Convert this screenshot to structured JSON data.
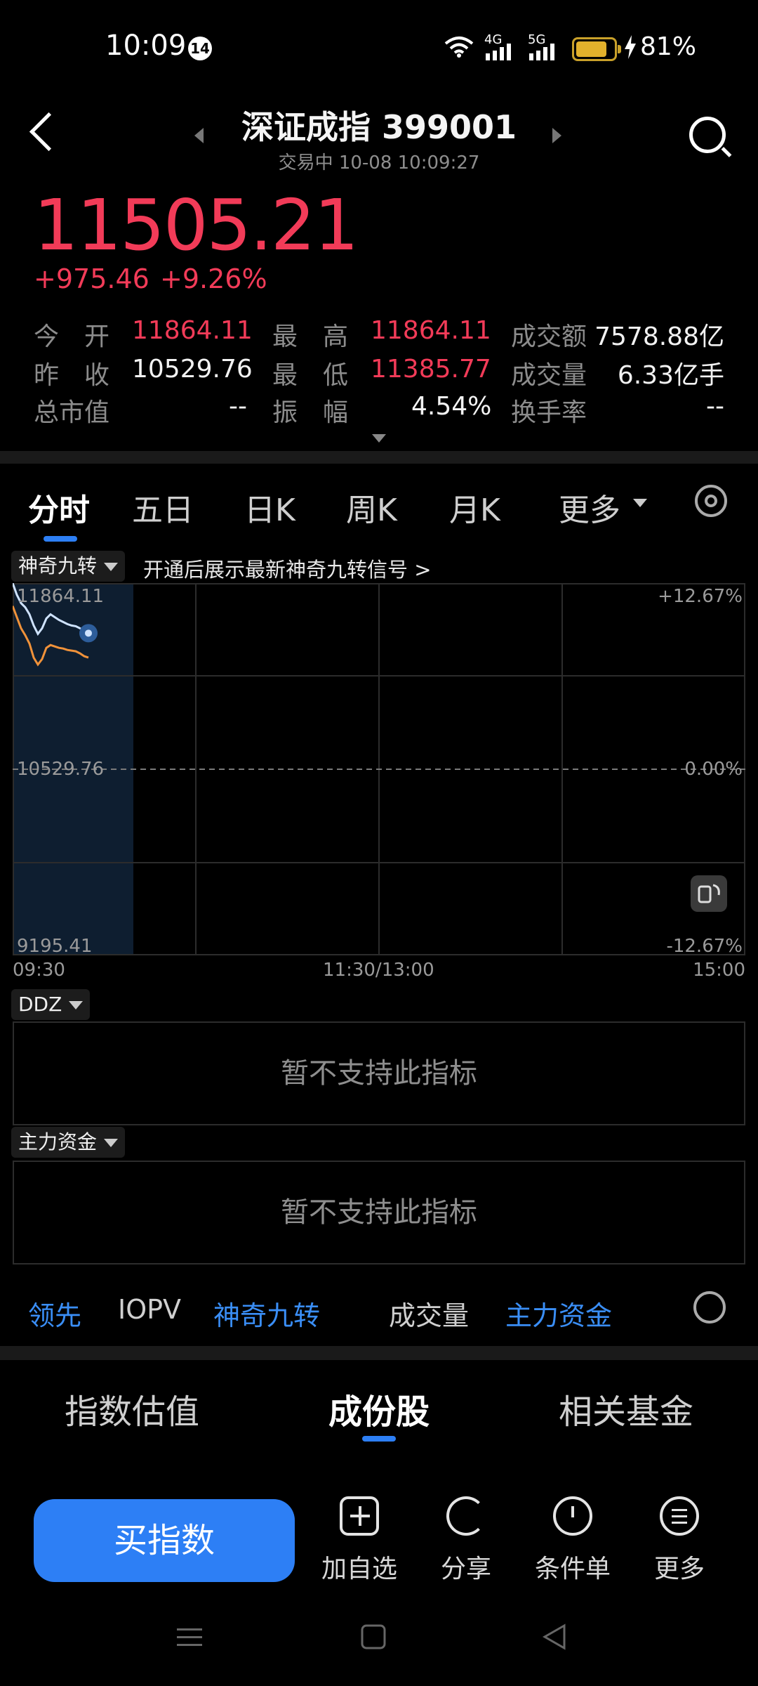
{
  "status_bar": {
    "time": "10:09",
    "notif_count": "14",
    "net1": "4G",
    "net2": "5G",
    "battery": "81%"
  },
  "header": {
    "title": "深证成指 399001",
    "subtitle": "交易中 10-08 10:09:27"
  },
  "quote": {
    "price": "11505.21",
    "change": "+975.46",
    "change_pct": "+9.26%"
  },
  "stats": {
    "open_label": "今　开",
    "open": "11864.11",
    "high_label": "最　高",
    "high": "11864.11",
    "amount_label": "成交额",
    "amount": "7578.88亿",
    "prev_label": "昨　收",
    "prev": "10529.76",
    "low_label": "最　低",
    "low": "11385.77",
    "volume_label": "成交量",
    "volume": "6.33亿手",
    "mcap_label": "总市值",
    "mcap": "--",
    "amp_label": "振　幅",
    "amp": "4.54%",
    "turnover_label": "换手率",
    "turnover": "--"
  },
  "tabs": [
    "分时",
    "五日",
    "日K",
    "周K",
    "月K",
    "更多"
  ],
  "chart_header": {
    "chip": "神奇九转",
    "promo": "开通后展示最新神奇九转信号 >"
  },
  "chart_data": {
    "type": "line",
    "y_left_labels": [
      "11864.11",
      "10529.76",
      "9195.41"
    ],
    "y_right_labels": [
      "+12.67%",
      "0.00%",
      "-12.67%"
    ],
    "x_labels": [
      "09:30",
      "11:30/13:00",
      "15:00"
    ],
    "ylim": [
      9195.41,
      11864.11
    ],
    "series": [
      {
        "color": "#cfe3ff",
        "values": [
          11864,
          11780,
          11720,
          11690,
          11640,
          11560,
          11500,
          11540,
          11610,
          11640,
          11620,
          11600,
          11585,
          11570,
          11560,
          11555,
          11540,
          11520,
          11505
        ]
      },
      {
        "color": "#f0923a",
        "values": [
          11700,
          11620,
          11540,
          11490,
          11430,
          11330,
          11280,
          11320,
          11400,
          11420,
          11410,
          11400,
          11395,
          11385,
          11380,
          11375,
          11360,
          11340,
          11330
        ]
      }
    ]
  },
  "ddz": {
    "chip": "DDZ",
    "msg": "暂不支持此指标"
  },
  "main_fund": {
    "chip": "主力资金",
    "msg": "暂不支持此指标"
  },
  "indicators": [
    "领先",
    "IOPV",
    "神奇九转",
    "成交量",
    "主力资金"
  ],
  "bottom_tabs": [
    "指数估值",
    "成份股",
    "相关基金"
  ],
  "action_bar": {
    "buy": "买指数",
    "add": "加自选",
    "share": "分享",
    "cond": "条件单",
    "more": "更多"
  },
  "colors": {
    "up": "#f23b58",
    "accent": "#2d7ff5"
  }
}
